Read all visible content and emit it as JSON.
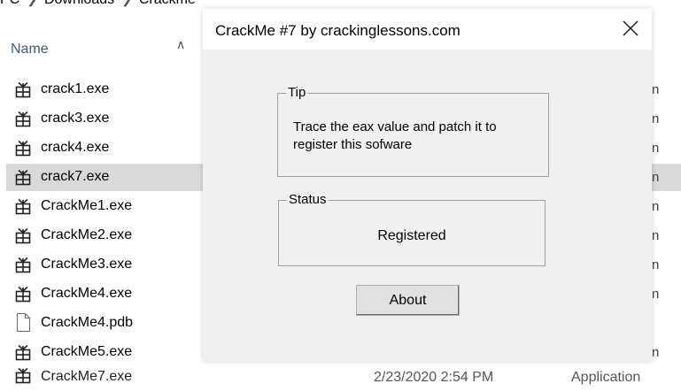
{
  "explorer": {
    "breadcrumb": [
      "PC",
      "Downloads",
      "Crackme"
    ],
    "column_header": "Name",
    "files": [
      {
        "name": "crack1.exe",
        "icon": "application-icon"
      },
      {
        "name": "crack3.exe",
        "icon": "application-icon"
      },
      {
        "name": "crack4.exe",
        "icon": "application-icon"
      },
      {
        "name": "crack7.exe",
        "icon": "application-icon",
        "selected": true
      },
      {
        "name": "CrackMe1.exe",
        "icon": "application-icon"
      },
      {
        "name": "CrackMe2.exe",
        "icon": "application-icon"
      },
      {
        "name": "CrackMe3.exe",
        "icon": "application-icon"
      },
      {
        "name": "CrackMe4.exe",
        "icon": "application-icon"
      },
      {
        "name": "CrackMe4.pdb",
        "icon": "document-icon"
      },
      {
        "name": "CrackMe5.exe",
        "icon": "application-icon"
      }
    ],
    "partial_row": {
      "name": "CrackMe7.exe",
      "date": "2/23/2020 2:54 PM",
      "type": "Application"
    },
    "right_fragment": "n"
  },
  "dialog": {
    "title": "CrackMe #7 by crackinglessons.com",
    "tip_label": "Tip",
    "tip_text": "Trace the eax value and patch it to register this sofware",
    "status_label": "Status",
    "status_text": "Registered",
    "about_button": "About"
  },
  "colors": {
    "selected_row": "#d9d9d9",
    "dialog_background": "#f0f0f0",
    "title_bar": "#ffffff"
  }
}
